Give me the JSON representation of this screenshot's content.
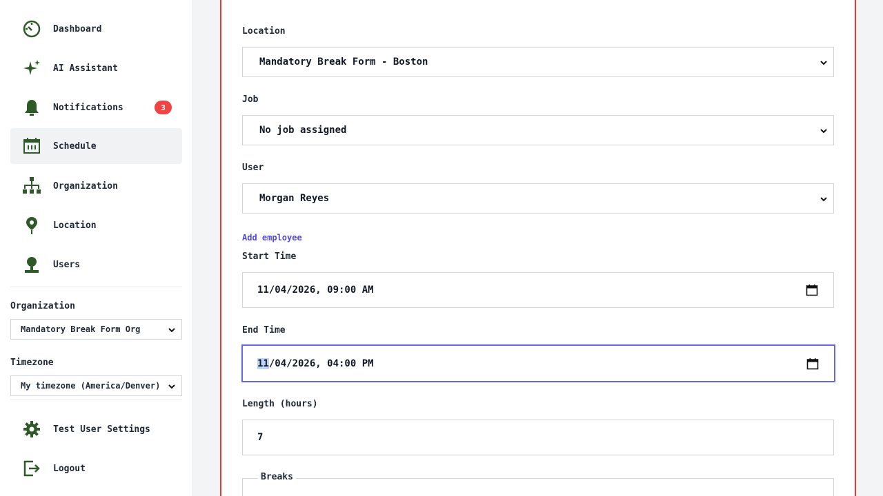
{
  "sidebar": {
    "items": [
      {
        "label": "Dashboard",
        "icon": "dashboard-icon"
      },
      {
        "label": "AI Assistant",
        "icon": "sparkle-icon"
      },
      {
        "label": "Notifications",
        "icon": "bell-icon",
        "badge": "3"
      },
      {
        "label": "Schedule",
        "icon": "calendar-icon",
        "active": true
      },
      {
        "label": "Organization",
        "icon": "org-chart-icon"
      },
      {
        "label": "Location",
        "icon": "map-pin-icon"
      },
      {
        "label": "Users",
        "icon": "user-icon"
      }
    ],
    "organization_label": "Organization",
    "organization_value": "Mandatory Break Form Org",
    "timezone_label": "Timezone",
    "timezone_value": "My timezone (America/Denver)",
    "settings_label": "Test User Settings",
    "logout_label": "Logout"
  },
  "form": {
    "location_label": "Location",
    "location_value": "Mandatory Break Form - Boston",
    "job_label": "Job",
    "job_value": "No job assigned",
    "user_label": "User",
    "user_value": "Morgan Reyes",
    "add_employee_link": "Add employee",
    "start_label": "Start Time",
    "start_value": "11/04/2026, 09:00 AM",
    "end_label": "End Time",
    "end_value_selected": "11",
    "end_value_rest": "/04/2026, 04:00 PM",
    "length_label": "Length (hours)",
    "length_value": "7",
    "breaks_legend": "Breaks"
  },
  "colors": {
    "icon_green": "#2d5a27",
    "accent": "#6366f1",
    "card_border": "#e53935",
    "badge": "#ef4444",
    "link": "#4f46e5"
  }
}
